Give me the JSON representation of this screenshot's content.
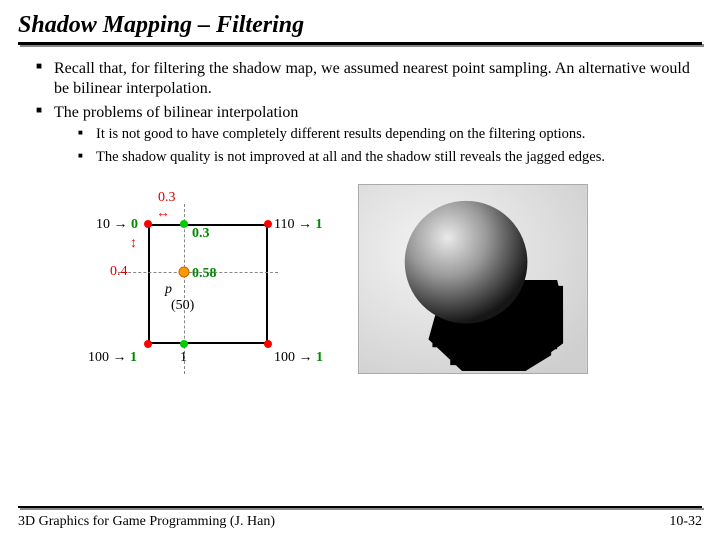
{
  "title": "Shadow Mapping – Filtering",
  "bullets": {
    "b1": "Recall that, for filtering the shadow map, we assumed nearest point sampling. An alternative would be bilinear interpolation.",
    "b2": "The problems of bilinear interpolation",
    "s1": "It is not good to have completely different results depending on the filtering options.",
    "s2": "The shadow quality is not improved at all and the shadow still reveals the jagged edges."
  },
  "diagram": {
    "top_offset": "0.3",
    "left_offset": "0.4",
    "interp_top": "0.3",
    "interp_center": "0.58",
    "point_label": "p",
    "point_depth": "(50)",
    "tl_depth": "10",
    "tl_res": "0",
    "tr_depth": "110",
    "tr_res": "1",
    "bl_depth": "100",
    "bl_res": "1",
    "br_depth": "100",
    "br_res": "1",
    "bm_res": "1",
    "arrow": "→"
  },
  "footer": {
    "left": "3D Graphics for Game Programming (J. Han)",
    "right": "10-32"
  }
}
